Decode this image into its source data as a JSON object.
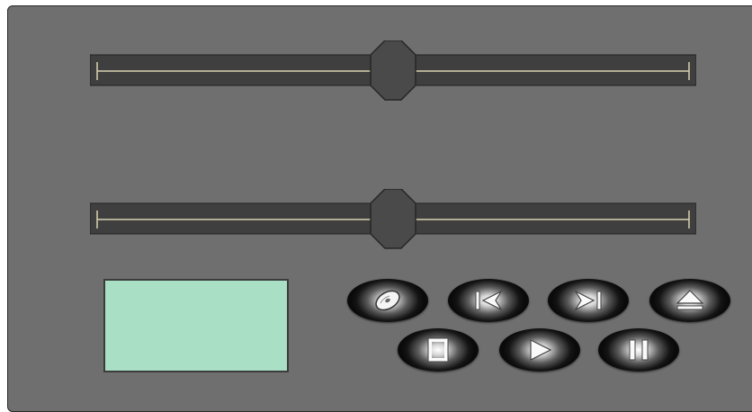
{
  "sliders": [
    {
      "name": "slider-1",
      "value": 0.5
    },
    {
      "name": "slider-2",
      "value": 0.5
    }
  ],
  "display": {
    "text": ""
  },
  "buttons": {
    "disc": {
      "icon": "disc-icon"
    },
    "previous": {
      "icon": "skip-back-icon"
    },
    "next": {
      "icon": "skip-forward-icon"
    },
    "eject": {
      "icon": "eject-icon"
    },
    "stop": {
      "icon": "stop-icon"
    },
    "play": {
      "icon": "play-icon"
    },
    "pause": {
      "icon": "pause-icon"
    }
  },
  "colors": {
    "panel": "#6f6f6f",
    "lcd": "#a9dfc5",
    "track": "#3f3f3f",
    "track_line": "#d8d2b0"
  }
}
